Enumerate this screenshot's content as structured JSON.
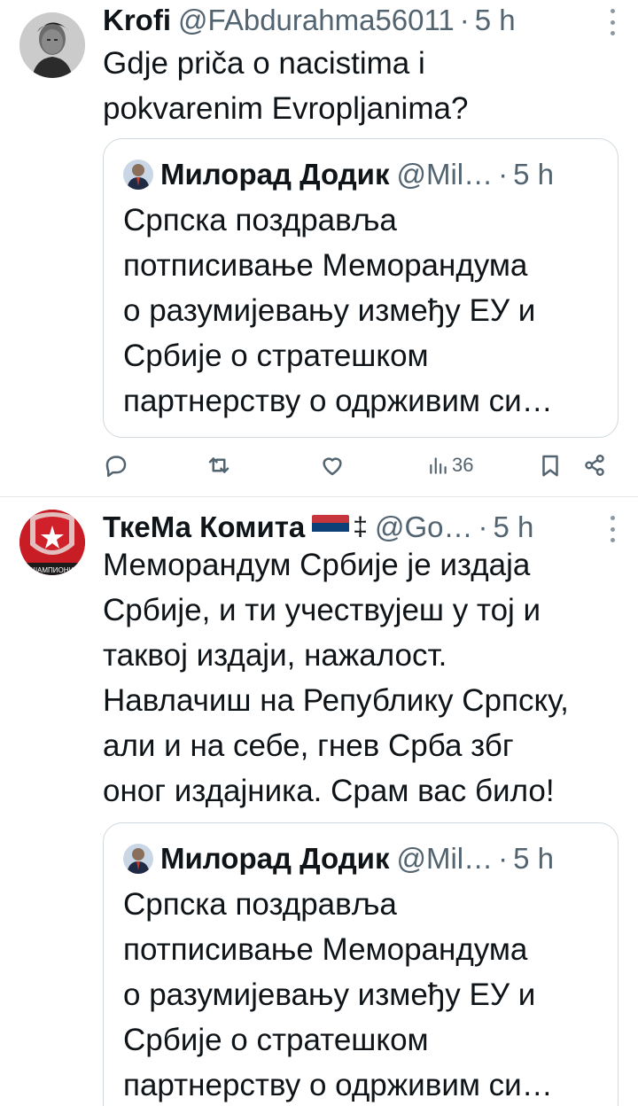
{
  "tweets": [
    {
      "author_name": "Krofi",
      "author_handle": "@FAbdurahma56011",
      "separator": "·",
      "time": "5 h",
      "text": "Gdje priča o nacistima i\npokvarenim Evropljanima?",
      "quote": {
        "author_name": "Милорад Додик",
        "author_handle": "@Mil…",
        "separator": "·",
        "time": "5 h",
        "text": "Српска поздравља\nпотписивање Меморандума\nо разумијевању између ЕУ и\nСрбије о стратешком\nпартнерству о одрживим си…"
      },
      "actions": {
        "reply_icon": "reply-icon",
        "retweet_icon": "retweet-icon",
        "like_icon": "like-icon",
        "views_icon": "views-icon",
        "views_count": "36",
        "bookmark_icon": "bookmark-icon",
        "share_icon": "share-icon"
      }
    },
    {
      "author_name": "ТкеМа Комита",
      "author_badge": "‡",
      "author_handle": "@Go…",
      "separator": "·",
      "time": "5 h",
      "text": "Меморандум Србије је издаја\nСрбије, и ти учествујеш у тој и\nтаквој издаји, нажалост.\nНавлачиш на Републику Српску,\nали и на себе, гнев Срба збг\nоног издајника. Срам вас било!",
      "quote": {
        "author_name": "Милорад Додик",
        "author_handle": "@Mil…",
        "separator": "·",
        "time": "5 h",
        "text": "Српска поздравља\nпотписивање Меморандума\nо разумијевању између ЕУ и\nСрбије о стратешком\nпартнерству о одрживим си…"
      }
    }
  ],
  "colors": {
    "text_primary": "#0f1419",
    "text_secondary": "#536471",
    "border": "#cfd9de",
    "divider": "#e6e9ec",
    "flag_red": "#c6363c",
    "flag_blue": "#0c4076",
    "flag_white": "#ffffff"
  }
}
